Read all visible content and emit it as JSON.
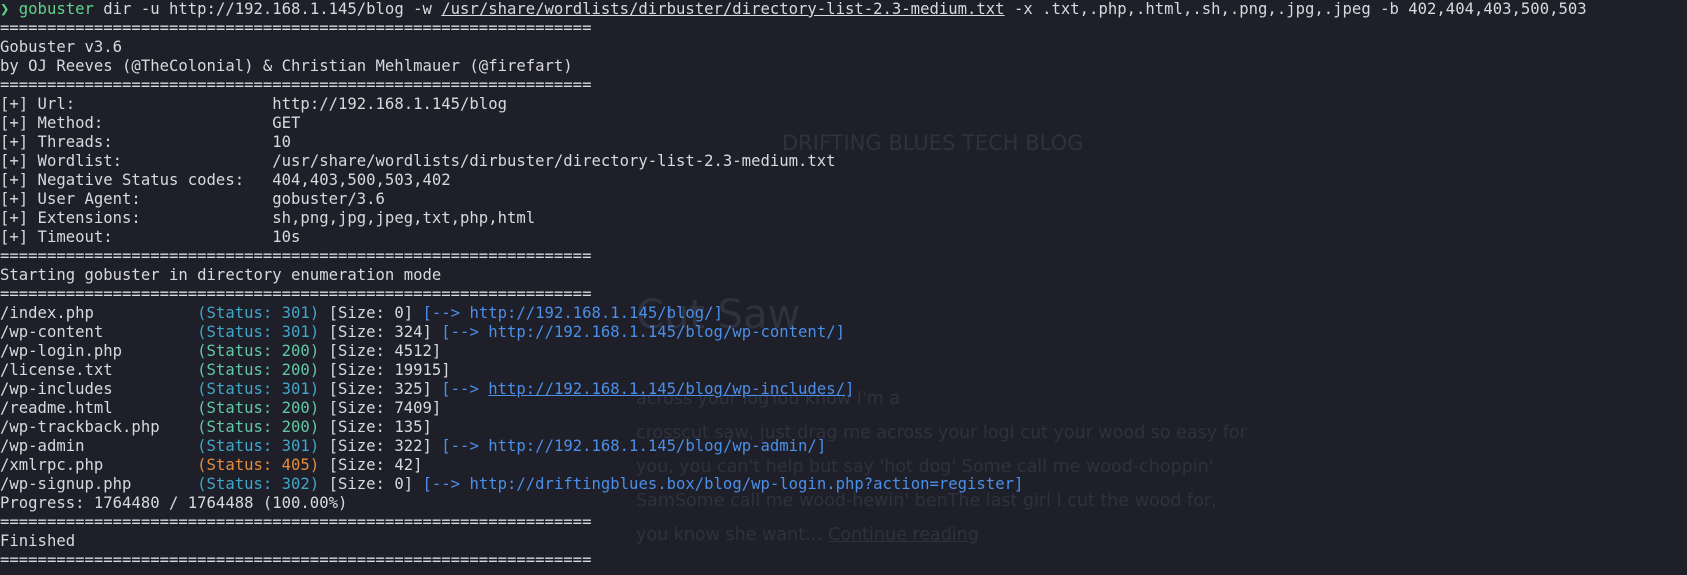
{
  "background_page": {
    "site_title": "DRIFTING BLUES TECH BLOG",
    "post_title": "Cut Saw",
    "post_lines": [
      "across your logYou know I'm a",
      "crosscut saw, just drag me across your logI cut your wood so easy for",
      "you, you can't help but say 'hot dog' Some call me wood-choppin'",
      "SamSome call me wood-hewin' benThe last girl I cut the wood for,"
    ],
    "post_last_line": "you know she want…",
    "continue_link": "Continue reading"
  },
  "command": {
    "prompt_symbol": "❯",
    "program": "gobuster",
    "args_before_wordlist": " dir -u http://192.168.1.145/blog -w ",
    "wordlist": "/usr/share/wordlists/dirbuster/directory-list-2.3-medium.txt",
    "args_after_wordlist": " -x .txt,.php,.html,.sh,.png,.jpg,.jpeg -b 402,404,403,500,503"
  },
  "separator": "===============================================================",
  "banner": {
    "version": "Gobuster v3.6",
    "authors": "by OJ Reeves (@TheColonial) & Christian Mehlmauer (@firefart)"
  },
  "config": [
    {
      "label": "[+] Url:                     ",
      "value": "http://192.168.1.145/blog"
    },
    {
      "label": "[+] Method:                  ",
      "value": "GET"
    },
    {
      "label": "[+] Threads:                 ",
      "value": "10"
    },
    {
      "label": "[+] Wordlist:                ",
      "value": "/usr/share/wordlists/dirbuster/directory-list-2.3-medium.txt"
    },
    {
      "label": "[+] Negative Status codes:   ",
      "value": "404,403,500,503,402"
    },
    {
      "label": "[+] User Agent:              ",
      "value": "gobuster/3.6"
    },
    {
      "label": "[+] Extensions:              ",
      "value": "sh,png,jpg,jpeg,txt,php,html"
    },
    {
      "label": "[+] Timeout:                 ",
      "value": "10s"
    }
  ],
  "mode_message": "Starting gobuster in directory enumeration mode",
  "results": [
    {
      "path": "/index.php           ",
      "status": "(Status: 301)",
      "status_color": "cyan",
      "size": " [Size: 0]",
      "redirect_prefix": " [--> ",
      "redirect_url": "http://192.168.1.145/blog/",
      "redirect_suffix": "]",
      "url_underlined": false
    },
    {
      "path": "/wp-content          ",
      "status": "(Status: 301)",
      "status_color": "cyan",
      "size": " [Size: 324]",
      "redirect_prefix": " [--> ",
      "redirect_url": "http://192.168.1.145/blog/wp-content/",
      "redirect_suffix": "]",
      "url_underlined": false
    },
    {
      "path": "/wp-login.php        ",
      "status": "(Status: 200)",
      "status_color": "green",
      "size": " [Size: 4512]",
      "redirect_prefix": "",
      "redirect_url": "",
      "redirect_suffix": "",
      "url_underlined": false
    },
    {
      "path": "/license.txt         ",
      "status": "(Status: 200)",
      "status_color": "green",
      "size": " [Size: 19915]",
      "redirect_prefix": "",
      "redirect_url": "",
      "redirect_suffix": "",
      "url_underlined": false
    },
    {
      "path": "/wp-includes         ",
      "status": "(Status: 301)",
      "status_color": "cyan",
      "size": " [Size: 325]",
      "redirect_prefix": " [--> ",
      "redirect_url": "http://192.168.1.145/blog/wp-includes/",
      "redirect_suffix": "]",
      "url_underlined": true
    },
    {
      "path": "/readme.html         ",
      "status": "(Status: 200)",
      "status_color": "green",
      "size": " [Size: 7409]",
      "redirect_prefix": "",
      "redirect_url": "",
      "redirect_suffix": "",
      "url_underlined": false
    },
    {
      "path": "/wp-trackback.php    ",
      "status": "(Status: 200)",
      "status_color": "green",
      "size": " [Size: 135]",
      "redirect_prefix": "",
      "redirect_url": "",
      "redirect_suffix": "",
      "url_underlined": false
    },
    {
      "path": "/wp-admin            ",
      "status": "(Status: 301)",
      "status_color": "cyan",
      "size": " [Size: 322]",
      "redirect_prefix": " [--> ",
      "redirect_url": "http://192.168.1.145/blog/wp-admin/",
      "redirect_suffix": "]",
      "url_underlined": false
    },
    {
      "path": "/xmlrpc.php          ",
      "status": "(Status: 405)",
      "status_color": "orange",
      "size": " [Size: 42]",
      "redirect_prefix": "",
      "redirect_url": "",
      "redirect_suffix": "",
      "url_underlined": false
    },
    {
      "path": "/wp-signup.php       ",
      "status": "(Status: 302)",
      "status_color": "cyan",
      "size": " [Size: 0]",
      "redirect_prefix": " [--> ",
      "redirect_url": "http://driftingblues.box/blog/wp-login.php?action=register",
      "redirect_suffix": "]",
      "url_underlined": false
    }
  ],
  "progress": "Progress: 1764480 / 1764488 (100.00%)",
  "finished": "Finished",
  "colors": {
    "background": "#1e1f29",
    "text": "#d8d9dc",
    "prompt_green": "#5fd38d",
    "status_cyan": "#3fa7c7",
    "status_green": "#60c8a2",
    "status_orange": "#e58d3d",
    "link_blue": "#4b8fe8"
  }
}
